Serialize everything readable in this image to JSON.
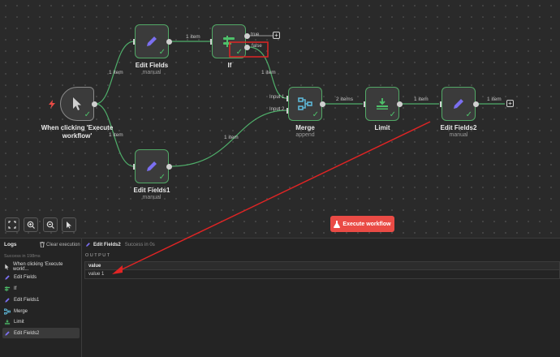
{
  "canvas": {
    "nodes": {
      "trigger": {
        "title": "When clicking 'Execute workflow'",
        "icon": "cursor-icon"
      },
      "edit_fields": {
        "title": "Edit Fields",
        "subtitle": "manual",
        "icon": "pencil-icon"
      },
      "if_node": {
        "title": "If",
        "icon": "if-branch-icon",
        "true_label": "true",
        "false_label": "false"
      },
      "edit_fields1": {
        "title": "Edit Fields1",
        "subtitle": "manual",
        "icon": "pencil-icon"
      },
      "merge": {
        "title": "Merge",
        "subtitle": "append",
        "icon": "merge-icon",
        "input1": "Input 1",
        "input2": "Input 2"
      },
      "limit": {
        "title": "Limit",
        "icon": "limit-icon"
      },
      "edit_fields2": {
        "title": "Edit Fields2",
        "subtitle": "manual",
        "icon": "pencil-icon"
      }
    },
    "edges": {
      "trigger_to_edit_fields": "1 item",
      "trigger_to_edit_fields1": "1 item",
      "edit_fields_to_if": "1 item",
      "if_to_merge": "1 item",
      "edit_fields1_to_merge": "1 item",
      "merge_to_limit": "2 items",
      "limit_to_edit_fields2": "1 item",
      "edit_fields2_out": "1 item"
    },
    "plus_label": "+",
    "execute_button": "Execute workflow"
  },
  "logs": {
    "title": "Logs",
    "clear_label": "Clear execution",
    "status": "Success in 198ms",
    "items": [
      {
        "label": "When clicking 'Execute workf...",
        "icon": "cursor-icon"
      },
      {
        "label": "Edit Fields",
        "icon": "pencil-icon"
      },
      {
        "label": "If",
        "icon": "if-branch-icon"
      },
      {
        "label": "Edit Fields1",
        "icon": "pencil-icon"
      },
      {
        "label": "Merge",
        "icon": "merge-icon"
      },
      {
        "label": "Limit",
        "icon": "limit-icon"
      },
      {
        "label": "Edit Fields2",
        "icon": "pencil-icon"
      }
    ]
  },
  "output": {
    "node_name": "Edit Fields2",
    "status": "Success in 0s",
    "label": "OUTPUT",
    "column": "value",
    "rows": [
      "value 1"
    ]
  },
  "colors": {
    "accent": "#ea4b45",
    "success": "#4ec06a",
    "pencil": "#7b6ff0",
    "annotation": "#e02424"
  }
}
